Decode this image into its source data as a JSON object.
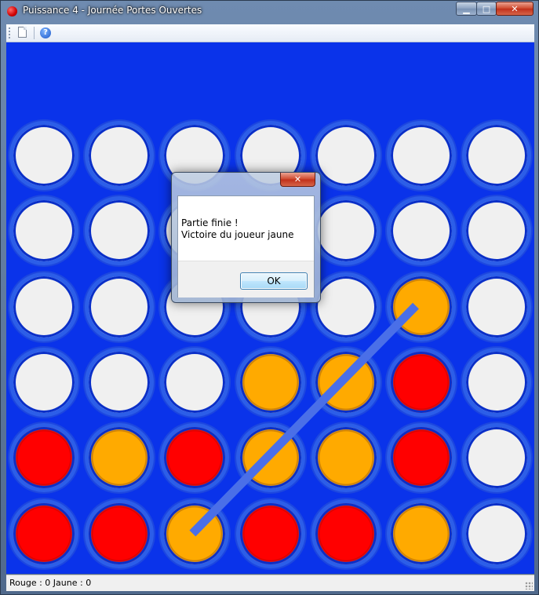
{
  "window": {
    "title": "Puissance 4 - Journée Portes Ouvertes",
    "icon": "red-disc-icon",
    "controls": {
      "minimize": "▁",
      "maximize": "□",
      "close": "✕"
    }
  },
  "toolbar": {
    "items": [
      {
        "name": "new-game-button",
        "icon": "new-document-icon"
      },
      {
        "name": "help-button",
        "icon": "help-icon",
        "glyph": "?"
      }
    ]
  },
  "board": {
    "columns": 7,
    "rows": 6,
    "colors": {
      "board": "#0a33ea",
      "red": "#ff0000",
      "yellow": "#ffaa00",
      "empty": "#f0f0f0",
      "win_line": "#4a6fe8"
    },
    "grid": [
      [
        "empty",
        "empty",
        "empty",
        "empty",
        "empty",
        "empty",
        "empty"
      ],
      [
        "empty",
        "empty",
        "empty",
        "empty",
        "empty",
        "empty",
        "empty"
      ],
      [
        "empty",
        "empty",
        "empty",
        "empty",
        "empty",
        "yellow",
        "empty"
      ],
      [
        "empty",
        "empty",
        "empty",
        "yellow",
        "yellow",
        "red",
        "empty"
      ],
      [
        "red",
        "yellow",
        "red",
        "yellow",
        "yellow",
        "red",
        "empty"
      ],
      [
        "red",
        "red",
        "yellow",
        "red",
        "red",
        "yellow",
        "empty"
      ]
    ],
    "winning_line": {
      "from": [
        5,
        2
      ],
      "to": [
        2,
        5
      ]
    }
  },
  "status": {
    "text": "Rouge : 0  Jaune : 0"
  },
  "dialog": {
    "close": "✕",
    "message_line1": "Partie finie !",
    "message_line2": "Victoire du joueur jaune",
    "ok_label": "OK"
  }
}
